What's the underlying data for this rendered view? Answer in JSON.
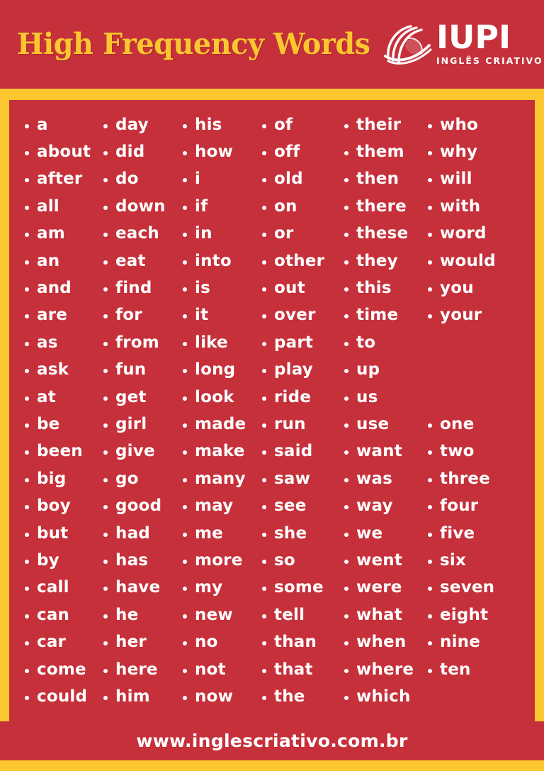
{
  "header": {
    "title": "High Frequency Words",
    "logo": {
      "name": "IUPI",
      "tagline": "INGLÊS CRIATIVO",
      "mark": "swoosh-ball-icon"
    }
  },
  "colors": {
    "background_red": "#C6303A",
    "accent_yellow": "#FBC62F",
    "text_white": "#FFFFFF"
  },
  "footer": {
    "url": "www.inglescriativo.com.br"
  },
  "word_list": {
    "columns": [
      {
        "index": 0,
        "words": [
          "a",
          "about",
          "after",
          "all",
          "am",
          "an",
          "and",
          "are",
          "as",
          "ask",
          "at",
          "be",
          "been",
          "big",
          "boy",
          "but",
          "by",
          "call",
          "can",
          "car",
          "come",
          "could"
        ]
      },
      {
        "index": 1,
        "words": [
          "day",
          "did",
          "do",
          "down",
          "each",
          "eat",
          "find",
          "for",
          "from",
          "fun",
          "get",
          "girl",
          "give",
          "go",
          "good",
          "had",
          "has",
          "have",
          "he",
          "her",
          "here",
          "him"
        ]
      },
      {
        "index": 2,
        "words": [
          "his",
          "how",
          "i",
          "if",
          "in",
          "into",
          "is",
          "it",
          "like",
          "long",
          "look",
          "made",
          "make",
          "many",
          "may",
          "me",
          "more",
          "my",
          "new",
          "no",
          "not",
          "now"
        ]
      },
      {
        "index": 3,
        "words": [
          "of",
          "off",
          "old",
          "on",
          "or",
          "other",
          "out",
          "over",
          "part",
          "play",
          "ride",
          "run",
          "said",
          "saw",
          "see",
          "she",
          "so",
          "some",
          "tell",
          "than",
          "that",
          "the"
        ]
      },
      {
        "index": 4,
        "words": [
          "their",
          "them",
          "then",
          "there",
          "these",
          "they",
          "this",
          "time",
          "to",
          "up",
          "us",
          "use",
          "want",
          "was",
          "way",
          "we",
          "went",
          "were",
          "what",
          "when",
          "where",
          "which"
        ]
      },
      {
        "index": 5,
        "words": [
          "who",
          "why",
          "will",
          "with",
          "word",
          "would",
          "you",
          "your",
          "",
          "",
          "",
          "one",
          "two",
          "three",
          "four",
          "five",
          "six",
          "seven",
          "eight",
          "nine",
          "ten",
          ""
        ]
      }
    ]
  }
}
